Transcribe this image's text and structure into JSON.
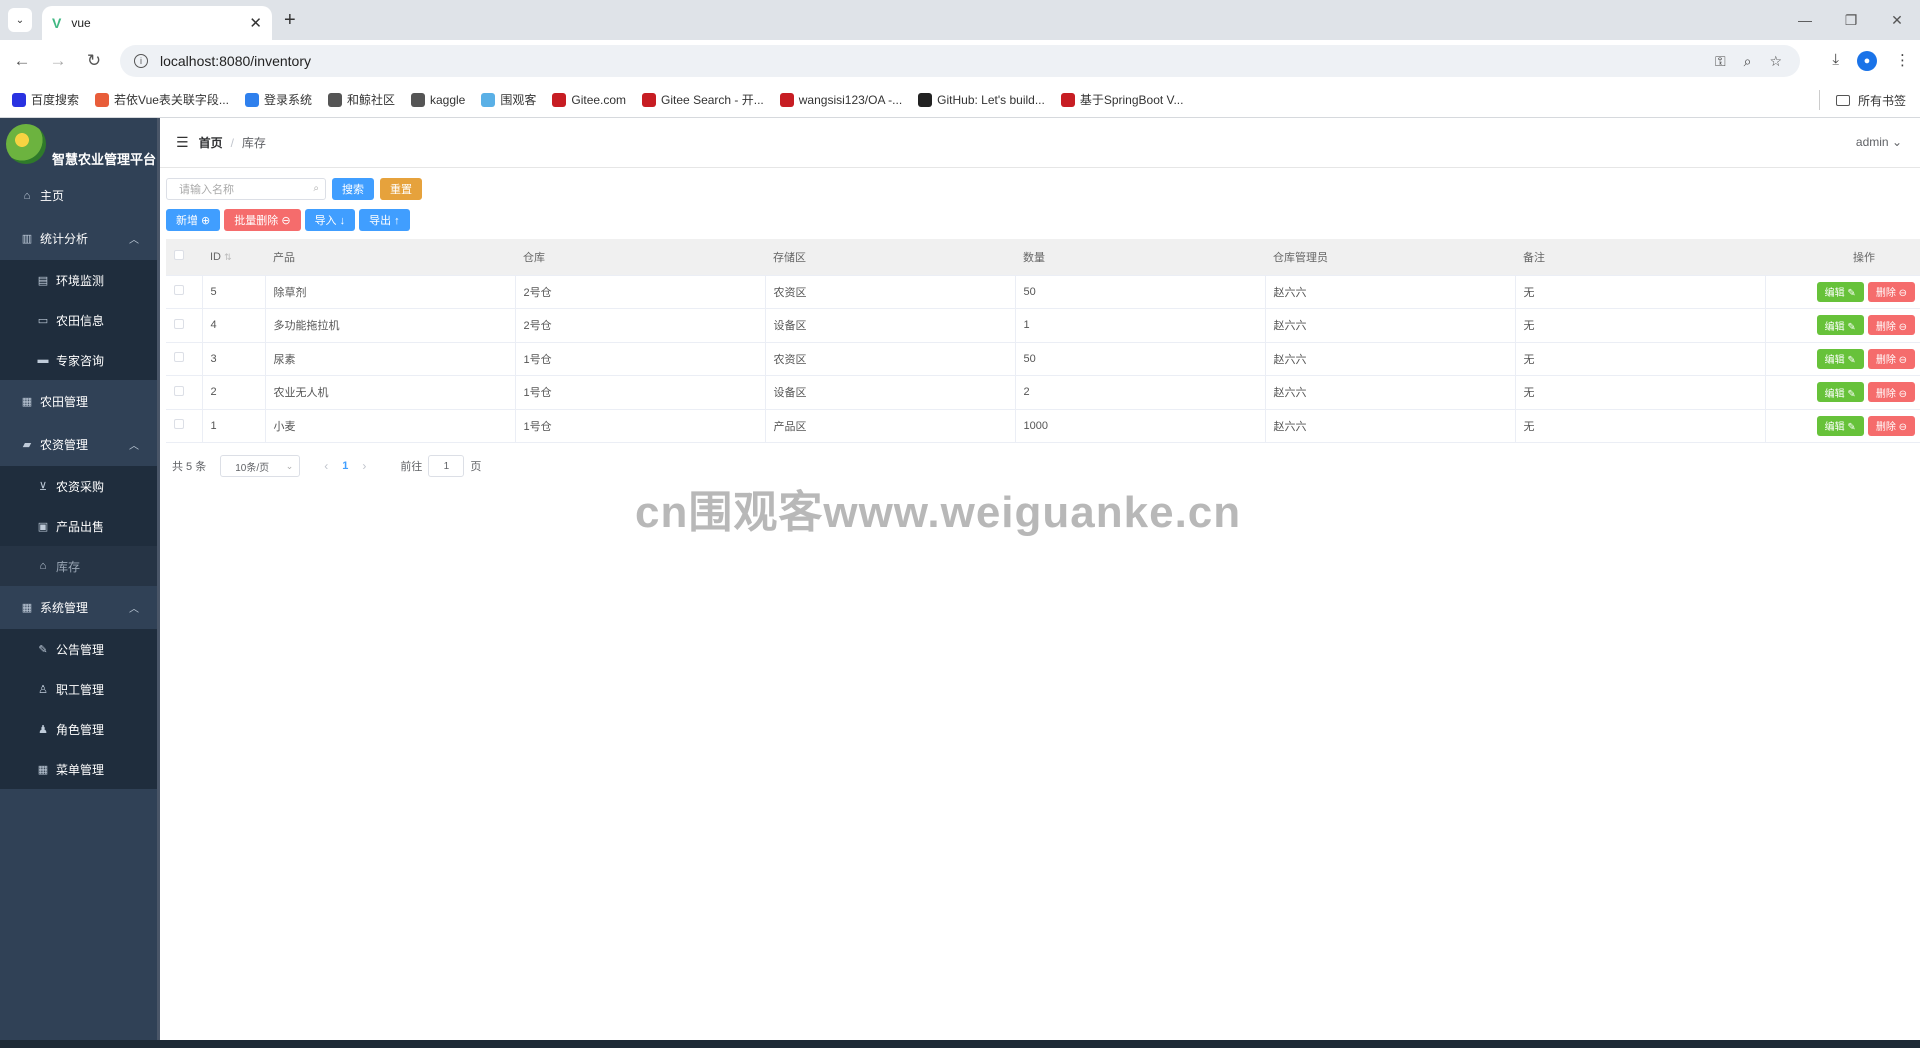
{
  "browser": {
    "tab_title": "vue",
    "url": "localhost:8080/inventory",
    "bookmarks": [
      {
        "label": "百度搜索",
        "color": "#2932e1"
      },
      {
        "label": "若依Vue表关联字段...",
        "color": "#e85d3a"
      },
      {
        "label": "登录系统",
        "color": "#2f80ed"
      },
      {
        "label": "和鲸社区",
        "color": "#555555"
      },
      {
        "label": "kaggle",
        "color": "#555555"
      },
      {
        "label": "围观客",
        "color": "#5ab0e6"
      },
      {
        "label": "Gitee.com",
        "color": "#c71d23"
      },
      {
        "label": "Gitee Search - 开...",
        "color": "#c71d23"
      },
      {
        "label": "wangsisi123/OA -...",
        "color": "#c71d23"
      },
      {
        "label": "GitHub: Let's build...",
        "color": "#222222"
      },
      {
        "label": "基于SpringBoot V...",
        "color": "#c71d23"
      }
    ],
    "all_bookmarks": "所有书签"
  },
  "sidebar": {
    "brand": "智慧农业管理平台",
    "items": [
      {
        "label": "主页",
        "icon": "home-icon",
        "level": 1
      },
      {
        "label": "统计分析",
        "icon": "chart-icon",
        "level": 1,
        "expanded": true
      },
      {
        "label": "环境监测",
        "icon": "doc-icon",
        "level": 2
      },
      {
        "label": "农田信息",
        "icon": "monitor-icon",
        "level": 2
      },
      {
        "label": "专家咨询",
        "icon": "chat-icon",
        "level": 2
      },
      {
        "label": "农田管理",
        "icon": "grid-icon",
        "level": 1
      },
      {
        "label": "农资管理",
        "icon": "bag-icon",
        "level": 1,
        "expanded": true
      },
      {
        "label": "农资采购",
        "icon": "cart-icon",
        "level": 2
      },
      {
        "label": "产品出售",
        "icon": "briefcase-icon",
        "level": 2
      },
      {
        "label": "库存",
        "icon": "home-icon",
        "level": 2,
        "active": true
      },
      {
        "label": "系统管理",
        "icon": "apps-icon",
        "level": 1,
        "expanded": true
      },
      {
        "label": "公告管理",
        "icon": "edit-icon",
        "level": 2
      },
      {
        "label": "职工管理",
        "icon": "user-icon",
        "level": 2
      },
      {
        "label": "角色管理",
        "icon": "user-solid-icon",
        "level": 2
      },
      {
        "label": "菜单管理",
        "icon": "menu-icon",
        "level": 2
      }
    ]
  },
  "header": {
    "breadcrumb_home": "首页",
    "breadcrumb_current": "库存",
    "user": "admin"
  },
  "search": {
    "placeholder": "请输入名称",
    "search_label": "搜索",
    "reset_label": "重置"
  },
  "actions": {
    "add": "新增 ⊕",
    "batch_delete": "批量删除 ⊖",
    "import": "导入 ↓",
    "export": "导出 ↑"
  },
  "table": {
    "columns": [
      "ID",
      "产品",
      "仓库",
      "存储区",
      "数量",
      "仓库管理员",
      "备注",
      "操作"
    ],
    "rows": [
      {
        "id": "5",
        "product": "除草剂",
        "warehouse": "2号仓",
        "area": "农资区",
        "qty": "50",
        "manager": "赵六六",
        "note": "无"
      },
      {
        "id": "4",
        "product": "多功能拖拉机",
        "warehouse": "2号仓",
        "area": "设备区",
        "qty": "1",
        "manager": "赵六六",
        "note": "无"
      },
      {
        "id": "3",
        "product": "尿素",
        "warehouse": "1号仓",
        "area": "农资区",
        "qty": "50",
        "manager": "赵六六",
        "note": "无"
      },
      {
        "id": "2",
        "product": "农业无人机",
        "warehouse": "1号仓",
        "area": "设备区",
        "qty": "2",
        "manager": "赵六六",
        "note": "无"
      },
      {
        "id": "1",
        "product": "小麦",
        "warehouse": "1号仓",
        "area": "产品区",
        "qty": "1000",
        "manager": "赵六六",
        "note": "无"
      }
    ],
    "edit_label": "编辑 ✎",
    "delete_label": "删除 ⊖"
  },
  "pagination": {
    "total": "共 5 条",
    "page_size": "10条/页",
    "current": "1",
    "goto_label": "前往",
    "goto_value": "1",
    "page_suffix": "页"
  },
  "watermark": "cn围观客www.weiguanke.cn"
}
